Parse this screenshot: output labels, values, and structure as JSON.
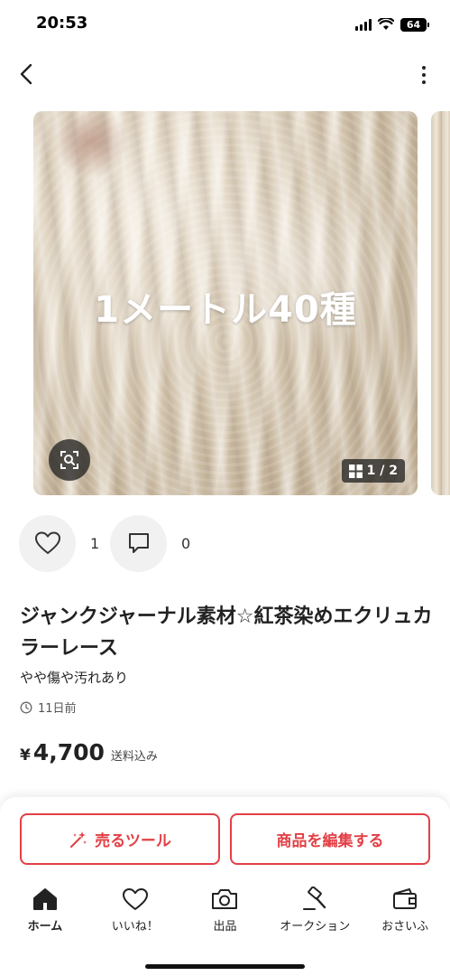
{
  "status_bar": {
    "time": "20:53",
    "battery": "64"
  },
  "gallery": {
    "overlay_text": "1メートル40種",
    "counter": "1 / 2"
  },
  "actions": {
    "likes": "1",
    "comments": "0"
  },
  "product": {
    "title": "ジャンクジャーナル素材☆紅茶染めエクリュカラーレース",
    "condition": "やや傷や汚れあり",
    "posted": "11日前",
    "price_currency": "¥",
    "price": "4,700",
    "shipping_note": "送料込み"
  },
  "buttons": {
    "sell_tool": "売るツール",
    "edit_item": "商品を編集する"
  },
  "tabbar": {
    "items": [
      {
        "label": "ホーム",
        "icon": "home-icon"
      },
      {
        "label": "いいね！",
        "icon": "heart-icon"
      },
      {
        "label": "出品",
        "icon": "camera-icon"
      },
      {
        "label": "オークション",
        "icon": "gavel-icon"
      },
      {
        "label": "おさいふ",
        "icon": "wallet-icon"
      }
    ]
  },
  "colors": {
    "accent": "#e33f45",
    "text": "#222222",
    "chip_bg": "#f1f1f1"
  }
}
